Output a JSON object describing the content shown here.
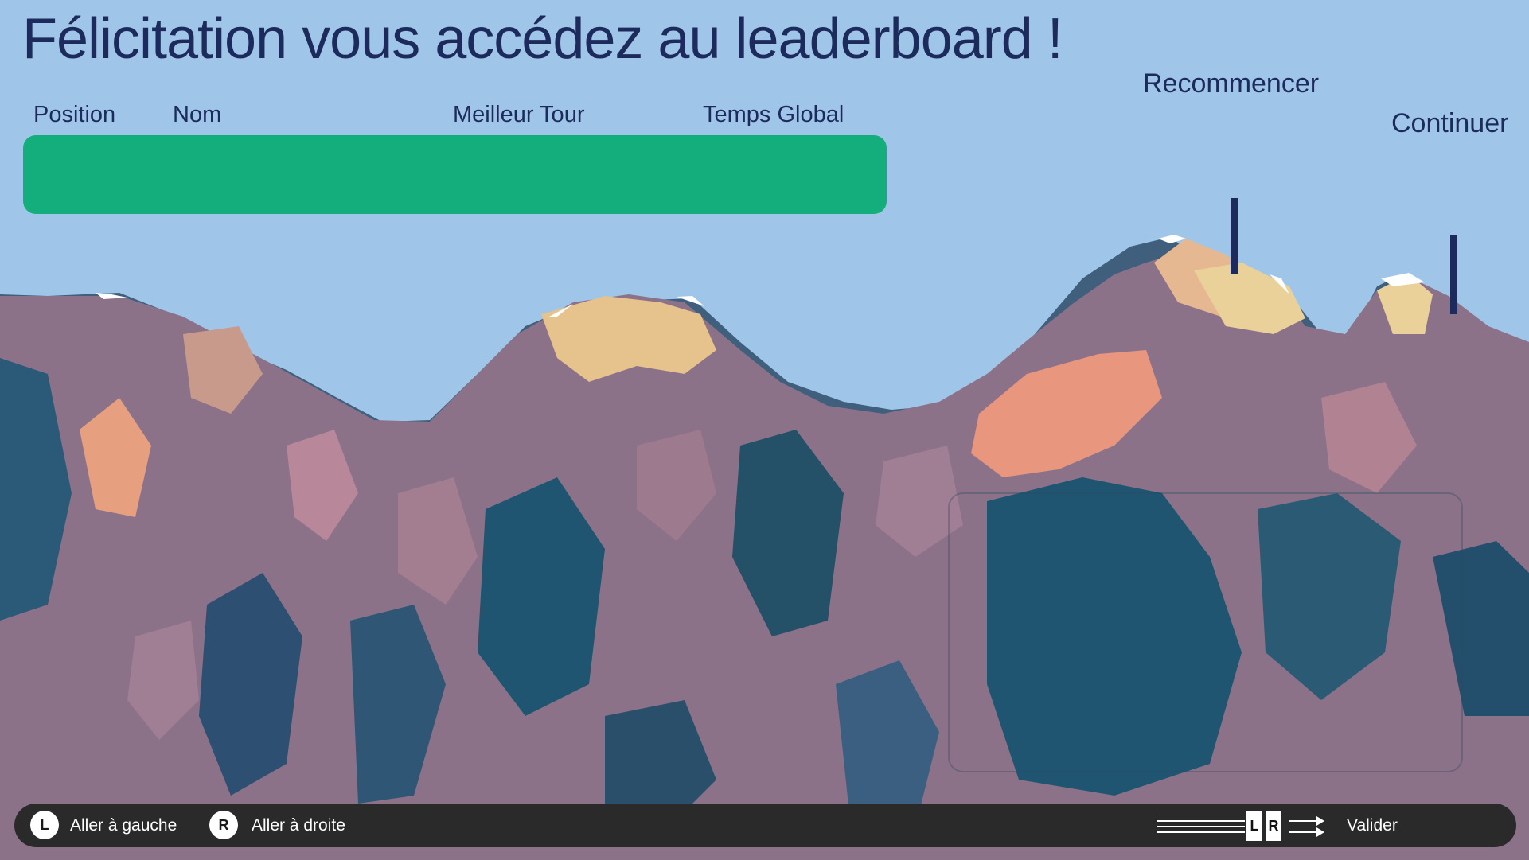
{
  "title": "Félicitation vous accédez au leaderboard !",
  "leaderboard": {
    "columns": [
      "Position",
      "Nom",
      "Meilleur Tour",
      "Temps Global"
    ],
    "highlight_color": "#14ae7d"
  },
  "menu": {
    "restart": "Recommencer",
    "continue": "Continuer"
  },
  "controls": {
    "left_key": "L",
    "left_label": "Aller à gauche",
    "right_key": "R",
    "right_label": "Aller à droite",
    "combo_left": "L",
    "combo_right": "R",
    "confirm_label": "Valider"
  },
  "colors": {
    "sky": "#9fc6e8",
    "text": "#1d2a5c",
    "mountain_dark": "#1f5570",
    "mountain_mid": "#8a6f8c",
    "mountain_warm": "#e8967d"
  }
}
